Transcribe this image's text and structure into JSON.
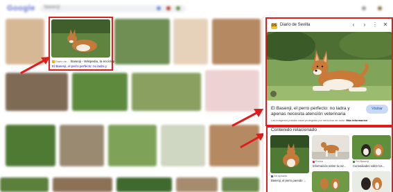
{
  "colors": {
    "highlight": "#e21b1b",
    "link": "#1a0dab",
    "visit_bg": "#c9d9f5",
    "visit_text": "#0b57d0"
  },
  "search": {
    "logo": "Google",
    "query": "basenji"
  },
  "highlighted_result": {
    "source": "Diario de...",
    "title": "Basenji - Wikipedia, la enciclop",
    "caption": "El Basenji, el perro perfecto: no ladra y"
  },
  "preview": {
    "site_name": "Diario de Sevilla",
    "favicon_text": "DS",
    "icons": [
      "chevron-left-icon",
      "chevron-right-icon",
      "more-vert-icon",
      "close-icon",
      "lens-icon"
    ],
    "title": "El Basenji, el perro perfecto: no ladra y apenas necesita atención veterinaria",
    "visit_label": "Visitar",
    "disclaimer": "Las imágenes pueden estar protegidas por derechos de autor.",
    "disclaimer_link": "Más información"
  },
  "related": {
    "heading": "Contenido relacionado",
    "items": [
      {
        "source": "Zeruploads",
        "title": "Basenji, el perro pareido ..."
      },
      {
        "source": "Purina",
        "title": "Información sobre la raz..."
      },
      {
        "source": "Pet Basenji",
        "title": "Curiosidades sobre los..."
      }
    ]
  }
}
